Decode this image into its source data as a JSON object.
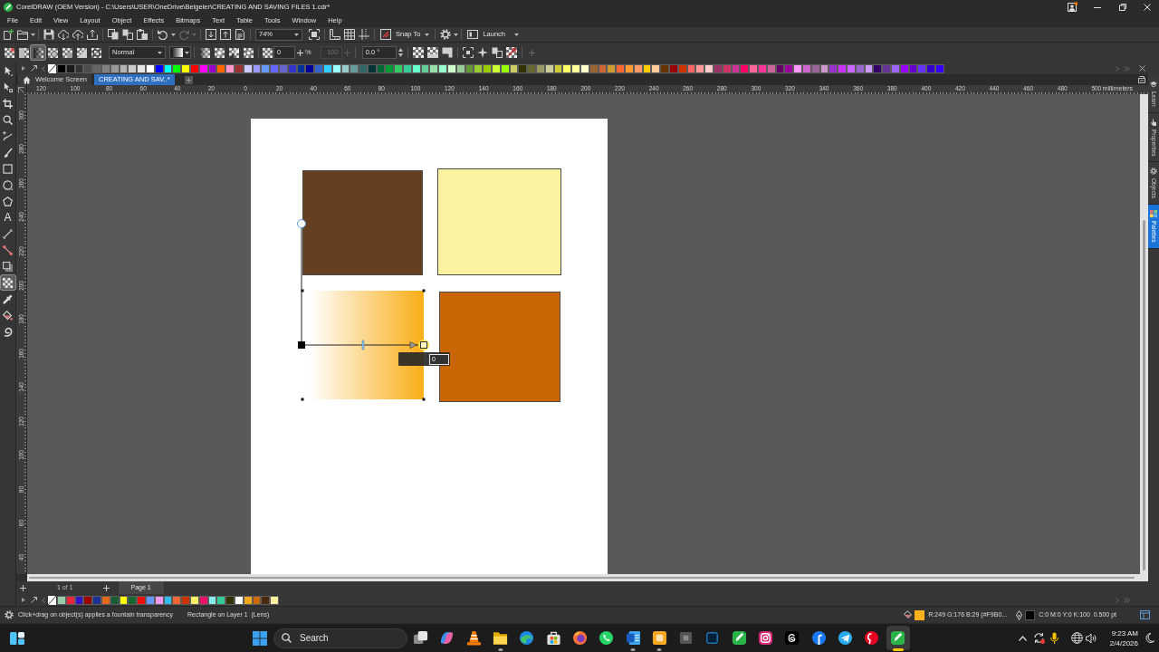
{
  "window": {
    "title": "CorelDRAW (OEM Version) - C:\\Users\\USER\\OneDrive\\Belgeler\\CREATING AND SAVING FILES 1.cdr*"
  },
  "menu": [
    "File",
    "Edit",
    "View",
    "Layout",
    "Object",
    "Effects",
    "Bitmaps",
    "Text",
    "Table",
    "Tools",
    "Window",
    "Help"
  ],
  "toolbar": {
    "zoom": "74%",
    "snap": "Snap To",
    "launch": "Launch"
  },
  "property_bar": {
    "transparency_types": [
      {
        "selected": false
      },
      {
        "selected": false
      },
      {
        "selected": true
      },
      {
        "selected": false
      },
      {
        "selected": false
      },
      {
        "selected": false
      },
      {
        "selected": false
      }
    ],
    "merge_mode": "Normal",
    "node_transparency": "0",
    "node_unit": "%",
    "midpoint": {
      "value": "100",
      "disabled": true
    },
    "angle": "0.0 °"
  },
  "toolbox": [
    {
      "selected": false
    },
    {
      "selected": false
    },
    {
      "selected": false
    },
    {
      "selected": false
    },
    {
      "selected": false
    },
    {
      "selected": false
    },
    {
      "selected": false
    },
    {
      "selected": false
    },
    {
      "selected": false
    },
    {
      "glyph": "A",
      "selected": false
    },
    {
      "selected": false
    },
    {
      "selected": false
    },
    {
      "selected": false
    },
    {
      "selected": true
    },
    {
      "selected": false
    },
    {
      "selected": false
    },
    {
      "selected": false
    }
  ],
  "palette": {
    "swatches": [
      {
        "color": "#000000"
      },
      {
        "color": "#1a1a1a"
      },
      {
        "color": "#333333"
      },
      {
        "color": "#4d4d4d"
      },
      {
        "color": "#666666"
      },
      {
        "color": "#808080"
      },
      {
        "color": "#999999"
      },
      {
        "color": "#b3b3b3"
      },
      {
        "color": "#cccccc"
      },
      {
        "color": "#e6e6e6"
      },
      {
        "color": "#ffffff"
      },
      {
        "color": "#0000ff"
      },
      {
        "color": "#00ffff"
      },
      {
        "color": "#00ff00"
      },
      {
        "color": "#ffff00"
      },
      {
        "color": "#ff0000"
      },
      {
        "color": "#ff00ff"
      },
      {
        "color": "#9900cc"
      },
      {
        "color": "#ff6600"
      },
      {
        "color": "#ff99cc"
      },
      {
        "color": "#993333"
      },
      {
        "color": "#ccccff"
      },
      {
        "color": "#9999ff"
      },
      {
        "color": "#6699ff"
      },
      {
        "color": "#6666ff"
      },
      {
        "color": "#6666cc"
      },
      {
        "color": "#3333cc"
      },
      {
        "color": "#003399"
      },
      {
        "color": "#000099"
      },
      {
        "color": "#3366cc"
      },
      {
        "color": "#33ccff"
      },
      {
        "color": "#99ffff"
      },
      {
        "color": "#99cccc"
      },
      {
        "color": "#669999"
      },
      {
        "color": "#336666"
      },
      {
        "color": "#003333"
      },
      {
        "color": "#006633"
      },
      {
        "color": "#009933"
      },
      {
        "color": "#33cc66"
      },
      {
        "color": "#33cc99"
      },
      {
        "color": "#66ffcc"
      },
      {
        "color": "#66cc99"
      },
      {
        "color": "#99ddaa"
      },
      {
        "color": "#99ffcc"
      },
      {
        "color": "#ccffcc"
      },
      {
        "color": "#99cc99"
      },
      {
        "color": "#669933"
      },
      {
        "color": "#99cc33"
      },
      {
        "color": "#99cc00"
      },
      {
        "color": "#ccff33"
      },
      {
        "color": "#99ff00"
      },
      {
        "color": "#cccc66"
      },
      {
        "color": "#333300"
      },
      {
        "color": "#666633"
      },
      {
        "color": "#999966"
      },
      {
        "color": "#cccc99"
      },
      {
        "color": "#cccc33"
      },
      {
        "color": "#ffff66"
      },
      {
        "color": "#ffff99"
      },
      {
        "color": "#ffffcc"
      },
      {
        "color": "#996633"
      },
      {
        "color": "#cc6633"
      },
      {
        "color": "#cc9933"
      },
      {
        "color": "#ff6633"
      },
      {
        "color": "#ff9933"
      },
      {
        "color": "#ff9966"
      },
      {
        "color": "#ffcc00"
      },
      {
        "color": "#ffcc99"
      },
      {
        "color": "#663300"
      },
      {
        "color": "#990000"
      },
      {
        "color": "#cc3300"
      },
      {
        "color": "#ff6666"
      },
      {
        "color": "#ff9999"
      },
      {
        "color": "#ffcccc"
      },
      {
        "color": "#993366"
      },
      {
        "color": "#cc3366"
      },
      {
        "color": "#cc3399"
      },
      {
        "color": "#ff0066"
      },
      {
        "color": "#ff6699"
      },
      {
        "color": "#ff3399"
      },
      {
        "color": "#cc6699"
      },
      {
        "color": "#660066"
      },
      {
        "color": "#990099"
      },
      {
        "color": "#ff99ff"
      },
      {
        "color": "#cc66cc"
      },
      {
        "color": "#996699"
      },
      {
        "color": "#cc99cc"
      },
      {
        "color": "#9933cc"
      },
      {
        "color": "#cc33ff"
      },
      {
        "color": "#cc66ff"
      },
      {
        "color": "#9966cc"
      },
      {
        "color": "#cc99ff"
      },
      {
        "color": "#330066"
      },
      {
        "color": "#663399"
      },
      {
        "color": "#9966ff"
      },
      {
        "color": "#9900ff"
      },
      {
        "color": "#6600cc"
      },
      {
        "color": "#6633ff"
      },
      {
        "color": "#3300cc"
      },
      {
        "color": "#3300ff"
      }
    ]
  },
  "tabs": [
    {
      "label": "Welcome Screen",
      "selected": false
    },
    {
      "label": "CREATING AND SAV..*",
      "selected": true
    }
  ],
  "rulers": {
    "horizontal": [
      "120",
      "100",
      "80",
      "60",
      "40",
      "20",
      "0",
      "20",
      "40",
      "60",
      "80",
      "100",
      "120",
      "140",
      "160",
      "180",
      "200",
      "220",
      "240",
      "260",
      "280",
      "300",
      "320",
      "340",
      "360",
      "380",
      "400",
      "420",
      "440",
      "460",
      "480",
      "500"
    ],
    "unit": "millimeters",
    "vertical": [
      "300",
      "280",
      "260",
      "240",
      "220",
      "200",
      "180",
      "160",
      "140",
      "120",
      "100",
      "80",
      "60",
      "40"
    ]
  },
  "page": {
    "shapes": [
      {
        "kind": "solid",
        "color": "#653f1f",
        "selected": false
      },
      {
        "kind": "solid",
        "color": "#fbf3a0",
        "selected": false
      },
      {
        "kind": "fountain",
        "color": "#f9b01d",
        "selected": true,
        "midpoint": {
          "level": 0.5
        },
        "node_transparency": "0"
      },
      {
        "kind": "solid",
        "color": "#c96505",
        "selected": false
      }
    ]
  },
  "page_navigator": {
    "counter": "1 of 1",
    "page_tab": "Page 1"
  },
  "document_palette": {
    "swatches": [
      {
        "color": "#99ccaa"
      },
      {
        "color": "#e8253a"
      },
      {
        "color": "#3311cc"
      },
      {
        "color": "#990000"
      },
      {
        "color": "#1a3399"
      },
      {
        "color": "#e8681a"
      },
      {
        "color": "#1a5c33"
      },
      {
        "color": "#ffff00"
      },
      {
        "color": "#1a6633"
      },
      {
        "color": "#ee1111"
      },
      {
        "color": "#6699ff"
      },
      {
        "color": "#ee99ee"
      },
      {
        "color": "#33bbee"
      },
      {
        "color": "#ee6633"
      },
      {
        "color": "#cc3300"
      },
      {
        "color": "#ffee66"
      },
      {
        "color": "#ee1166"
      },
      {
        "color": "#88eeee"
      },
      {
        "color": "#33cc99"
      },
      {
        "color": "#333300"
      },
      {
        "color": "#ffffff"
      },
      {
        "color": "#f2a81d"
      },
      {
        "color": "#cc6a05"
      },
      {
        "color": "#4a2a0a"
      },
      {
        "color": "#fbf0a0"
      }
    ]
  },
  "dockers": [
    {
      "label": "Learn",
      "selected": false
    },
    {
      "label": "Properties",
      "selected": false
    },
    {
      "label": "Objects",
      "selected": false
    },
    {
      "label": "Palettes",
      "selected": true
    }
  ],
  "status_bar": {
    "hint": "Click+drag on object(s) applies a fountain transparency",
    "selection": "Rectangle on Layer 1  (Lens)",
    "fill": {
      "color": "#f9b01d",
      "text": "R:249 G:176 B:29 (#F9B0..."
    },
    "outline": {
      "color": "#000000",
      "text": "C:0 M:0 Y:0 K:100  0.500 pt"
    }
  },
  "taskbar": {
    "search": {
      "placeholder": "Search"
    },
    "apps": [
      {
        "running": false,
        "selected": false
      },
      {
        "running": false,
        "selected": false
      },
      {
        "running": true,
        "selected": false
      },
      {
        "running": false,
        "selected": false
      },
      {
        "running": false,
        "selected": false
      },
      {
        "running": false,
        "selected": false
      },
      {
        "running": false,
        "selected": false
      },
      {
        "running": true,
        "selected": false
      },
      {
        "running": true,
        "selected": false
      },
      {
        "running": false,
        "selected": false
      },
      {
        "running": false,
        "selected": false
      },
      {
        "running": false,
        "selected": false
      },
      {
        "running": false,
        "selected": false
      },
      {
        "running": false,
        "selected": false
      },
      {
        "running": false,
        "selected": false
      },
      {
        "running": false,
        "selected": false
      },
      {
        "running": false,
        "selected": false
      },
      {
        "running": true,
        "selected": true
      }
    ],
    "time": "9:23 AM",
    "date": "2/4/2026"
  }
}
